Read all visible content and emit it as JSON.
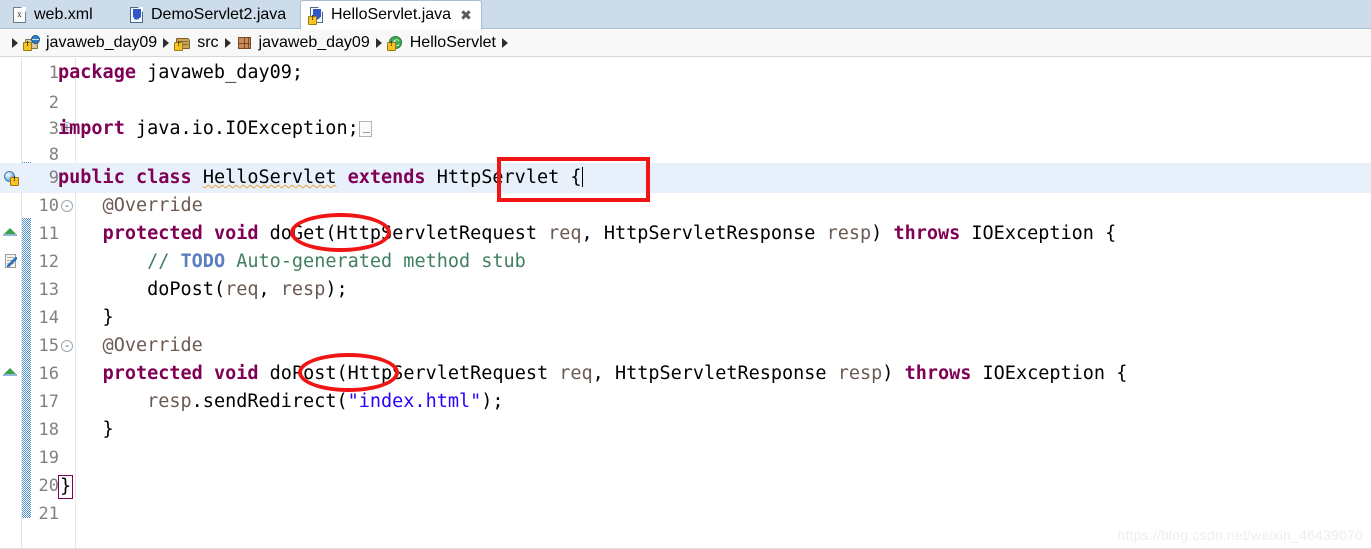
{
  "window": {
    "app": "Eclipse IDE Java Editor",
    "watermark": "https://blog.csdn.net/weixin_46439070"
  },
  "tabs": [
    {
      "label": "web.xml",
      "icon": "xml-file-icon",
      "active": false,
      "closeable": false
    },
    {
      "label": "DemoServlet2.java",
      "icon": "java-file-icon",
      "active": false,
      "closeable": false
    },
    {
      "label": "HelloServlet.java",
      "icon": "java-file-warning-icon",
      "active": true,
      "closeable": true,
      "close_glyph": "✖"
    }
  ],
  "breadcrumb": {
    "separator": "▶",
    "items": [
      {
        "label": "javaweb_day09",
        "icon": "web-project-icon"
      },
      {
        "label": "src",
        "icon": "source-folder-icon"
      },
      {
        "label": "javaweb_day09",
        "icon": "package-icon"
      },
      {
        "label": "HelloServlet",
        "icon": "java-class-icon"
      }
    ]
  },
  "editor": {
    "file": "HelloServlet.java",
    "lines": [
      {
        "num": "1",
        "fold": "",
        "marker": "",
        "highlight": false,
        "text": "package javaweb_day09;"
      },
      {
        "num": "2",
        "fold": "",
        "marker": "",
        "highlight": false,
        "text": ""
      },
      {
        "num": "3",
        "fold": "+",
        "marker": "",
        "highlight": false,
        "text": "import java.io.IOException;"
      },
      {
        "num": "8",
        "fold": "",
        "marker": "",
        "highlight": false,
        "text": ""
      },
      {
        "num": "9",
        "fold": "",
        "marker": "warning",
        "highlight": true,
        "text": "public class HelloServlet extends HttpServlet {"
      },
      {
        "num": "10",
        "fold": "-",
        "marker": "",
        "highlight": false,
        "text": "    @Override"
      },
      {
        "num": "11",
        "fold": "",
        "marker": "override",
        "highlight": false,
        "text": "    protected void doGet(HttpServletRequest req, HttpServletResponse resp) throws IOException {"
      },
      {
        "num": "12",
        "fold": "",
        "marker": "todo",
        "highlight": false,
        "text": "        // TODO Auto-generated method stub"
      },
      {
        "num": "13",
        "fold": "",
        "marker": "",
        "highlight": false,
        "text": "        doPost(req, resp);"
      },
      {
        "num": "14",
        "fold": "",
        "marker": "",
        "highlight": false,
        "text": "    }"
      },
      {
        "num": "15",
        "fold": "-",
        "marker": "",
        "highlight": false,
        "text": "    @Override"
      },
      {
        "num": "16",
        "fold": "",
        "marker": "override",
        "highlight": false,
        "text": "    protected void doPost(HttpServletRequest req, HttpServletResponse resp) throws IOException {"
      },
      {
        "num": "17",
        "fold": "",
        "marker": "",
        "highlight": false,
        "text": "        resp.sendRedirect(\"index.html\");"
      },
      {
        "num": "18",
        "fold": "",
        "marker": "",
        "highlight": false,
        "text": "    }"
      },
      {
        "num": "19",
        "fold": "",
        "marker": "",
        "highlight": false,
        "text": ""
      },
      {
        "num": "20",
        "fold": "",
        "marker": "",
        "highlight": false,
        "text": "}"
      },
      {
        "num": "21",
        "fold": "",
        "marker": "",
        "highlight": false,
        "text": ""
      }
    ],
    "tokens": {
      "l1_kw": "package",
      "l1_rest": " javaweb_day09;",
      "l3_kw": "import",
      "l3_rest": " java.io.IOException;",
      "l9_kw1": "public",
      "l9_kw2": "class",
      "l9_type": "HelloServlet",
      "l9_kw3": "extends",
      "l9_super": "HttpServlet",
      "l9_brace": " {",
      "l10_ann": "    @Override",
      "l11_kw1": "protected",
      "l11_kw2": "void",
      "l11_name": "doGet",
      "l11_p1type": "HttpServletRequest",
      "l11_p1name": "req",
      "l11_p2type": "HttpServletResponse",
      "l11_p2name": "resp",
      "l11_kw3": "throws",
      "l11_exc": "IOException",
      "l12_comment": "// ",
      "l12_todo": "TODO",
      "l12_tail": " Auto-generated method stub",
      "l13_call": "doPost",
      "l13_a1": "req",
      "l13_a2": "resp",
      "l15_ann": "    @Override",
      "l16_name": "doPost",
      "l17_recv": "resp",
      "l17_method": ".sendRedirect(",
      "l17_str": "\"index.html\"",
      "l17_tail": ");",
      "close_brace": "}"
    }
  },
  "annotations": [
    {
      "kind": "rectangle",
      "target": "HttpServlet",
      "color": "#f01414"
    },
    {
      "kind": "ellipse",
      "target": "doGet",
      "color": "#f01414"
    },
    {
      "kind": "ellipse",
      "target": "doPost",
      "color": "#f01414"
    }
  ]
}
